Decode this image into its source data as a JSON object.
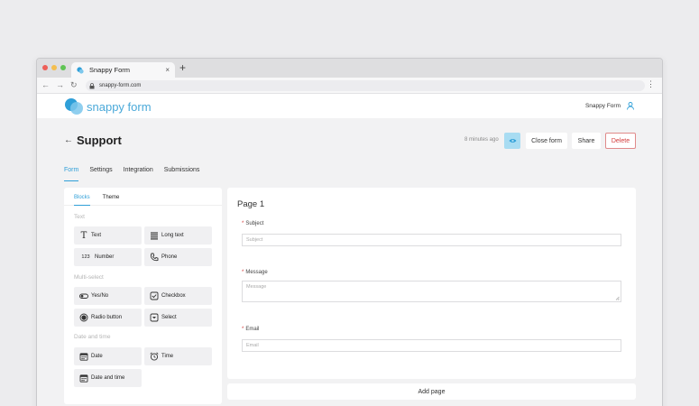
{
  "browser": {
    "tab_title": "Snappy Form",
    "tab_close": "×",
    "new_tab": "+",
    "url": "snappy-form.com",
    "colors": {
      "close": "#ee5f58",
      "minimize": "#f4be4f",
      "maximize": "#5fc454"
    }
  },
  "app": {
    "logo_text": "snappy form",
    "user_name": "Snappy Form",
    "brand_color": "#4aa9d9"
  },
  "page": {
    "title": "Support",
    "last_saved": "8 minutes ago",
    "close_form": "Close form",
    "share": "Share",
    "delete": "Delete",
    "tabs": [
      "Form",
      "Settings",
      "Integration",
      "Submissions"
    ]
  },
  "builder": {
    "tabs": [
      "Blocks",
      "Theme"
    ],
    "groups": {
      "text": "Text",
      "multi": "Multi-select",
      "datetime": "Date and time"
    },
    "blocks": {
      "text": {
        "label": "Text",
        "icon": "text-type-icon"
      },
      "long_text": {
        "label": "Long text",
        "icon": "paragraph-lines-icon"
      },
      "number": {
        "label": "Number",
        "icon": "number-icon",
        "glyph": "123"
      },
      "phone": {
        "label": "Phone",
        "icon": "phone-icon"
      },
      "yes_no": {
        "label": "Yes/No",
        "icon": "toggle-icon"
      },
      "checkbox": {
        "label": "Checkbox",
        "icon": "checkbox-icon"
      },
      "radio": {
        "label": "Radio button",
        "icon": "radio-icon"
      },
      "select": {
        "label": "Select",
        "icon": "select-icon"
      },
      "date": {
        "label": "Date",
        "icon": "calendar-icon"
      },
      "time": {
        "label": "Time",
        "icon": "alarm-clock-icon"
      },
      "date_time": {
        "label": "Date and time",
        "icon": "calendar-icon"
      }
    }
  },
  "form": {
    "page_title": "Page 1",
    "fields": {
      "subject": {
        "label": "Subject",
        "placeholder": "Subject"
      },
      "message": {
        "label": "Message",
        "placeholder": "Message"
      },
      "email": {
        "label": "Email",
        "placeholder": "Email"
      }
    },
    "required_mark": "*",
    "add_page": "Add page"
  }
}
